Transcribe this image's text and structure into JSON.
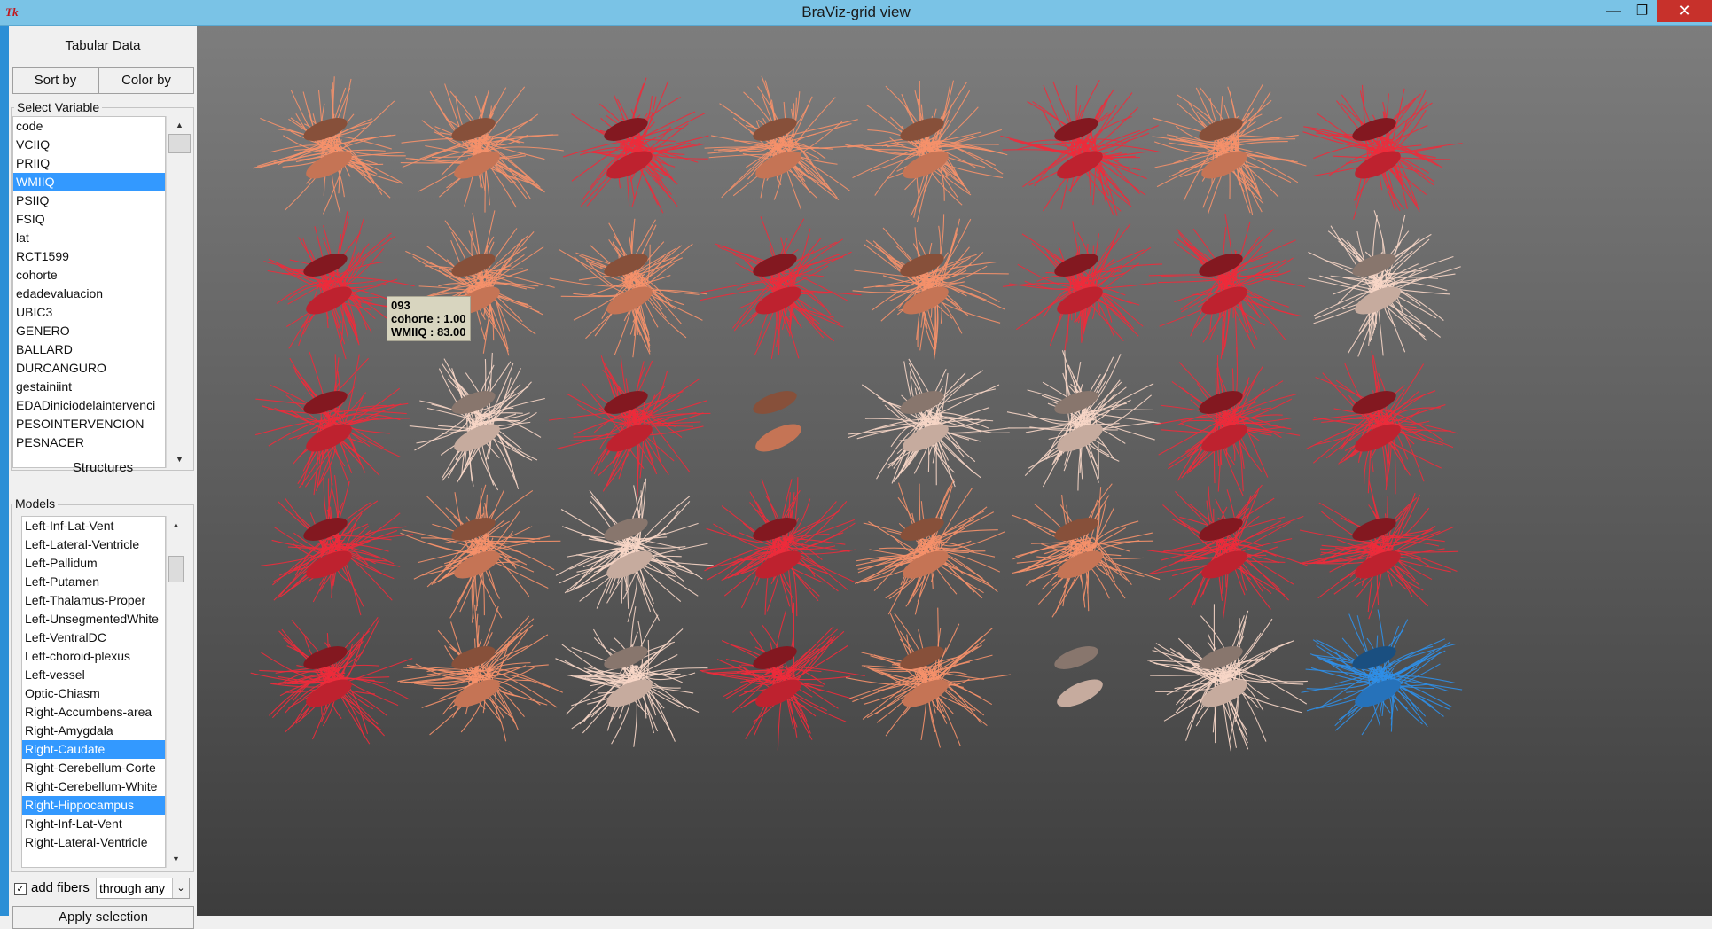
{
  "window": {
    "title": "BraViz-grid view",
    "app_icon": "Tk",
    "minimize": "—",
    "maximize": "❐",
    "close": "✕"
  },
  "sidebar": {
    "tabular_label": "Tabular Data",
    "sort_by": "Sort by",
    "color_by": "Color by",
    "select_variable_label": "Select Variable",
    "variables": [
      "code",
      "VCIIQ",
      "PRIIQ",
      "WMIIQ",
      "PSIIQ",
      "FSIQ",
      "lat",
      "RCT1599",
      "cohorte",
      "edadevaluacion",
      "UBIC3",
      "GENERO",
      "BALLARD",
      "DURCANGURO",
      "gestainiint",
      "EDADiniciodelaintervenci",
      "PESOINTERVENCION",
      "PESNACER"
    ],
    "selected_variable_index": 3,
    "structures_label": "Structures",
    "models_label": "Models",
    "models": [
      "Left-Inf-Lat-Vent",
      "Left-Lateral-Ventricle",
      "Left-Pallidum",
      "Left-Putamen",
      "Left-Thalamus-Proper",
      "Left-UnsegmentedWhite",
      "Left-VentralDC",
      "Left-choroid-plexus",
      "Left-vessel",
      "Optic-Chiasm",
      "Right-Accumbens-area",
      "Right-Amygdala",
      "Right-Caudate",
      "Right-Cerebellum-Corte",
      "Right-Cerebellum-White",
      "Right-Hippocampus",
      "Right-Inf-Lat-Vent",
      "Right-Lateral-Ventricle"
    ],
    "selected_models": [
      12,
      15
    ],
    "add_fibers_label": "add fibers",
    "add_fibers_checked": true,
    "fiber_mode": "through any",
    "apply_label": "Apply selection"
  },
  "grid": {
    "colors": {
      "dark_red": "#ee2b3b",
      "salmon": "#f6916a",
      "pale": "#f7d6c6",
      "blue": "#2f8fe8"
    },
    "tiles": [
      [
        "salmon",
        "salmon",
        "dark_red",
        "salmon",
        "salmon",
        "dark_red",
        "salmon",
        "dark_red"
      ],
      [
        "dark_red",
        "salmon",
        "salmon",
        "dark_red",
        "salmon",
        "dark_red",
        "dark_red",
        "pale"
      ],
      [
        "dark_red",
        "pale",
        "dark_red",
        "salmon-nofiber",
        "pale",
        "pale",
        "dark_red",
        "dark_red"
      ],
      [
        "dark_red",
        "salmon",
        "pale",
        "dark_red",
        "salmon",
        "salmon",
        "dark_red",
        "dark_red"
      ],
      [
        "dark_red",
        "salmon",
        "pale",
        "dark_red",
        "salmon",
        "pale-nofiber",
        "pale",
        "blue"
      ]
    ]
  },
  "tooltip": {
    "line1": "093",
    "line2": "cohorte : 1.00",
    "line3": "WMIIQ : 83.00"
  }
}
